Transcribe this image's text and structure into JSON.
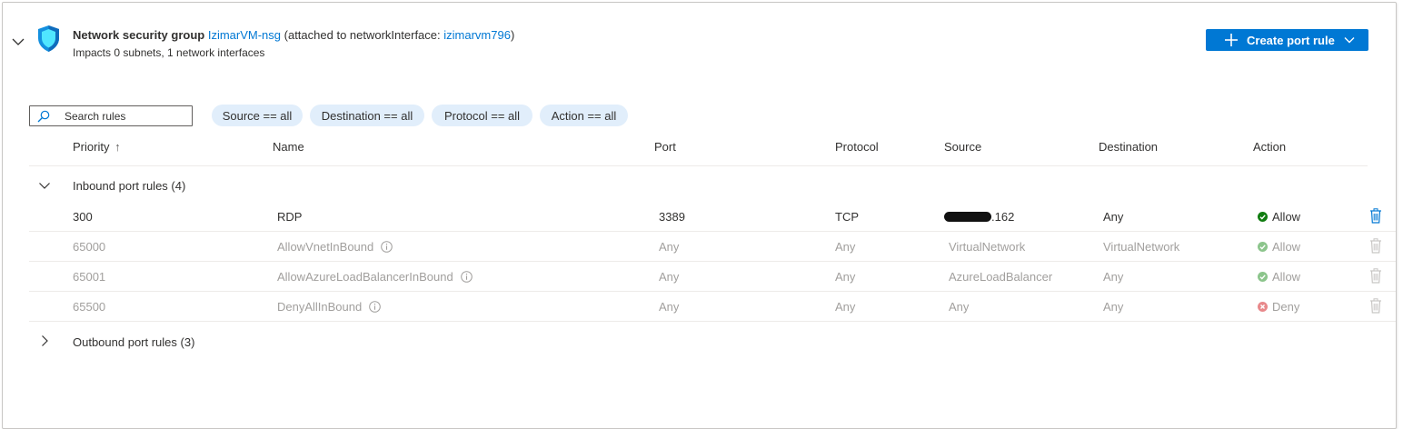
{
  "nsg": {
    "label": "Network security group",
    "name": "IzimarVM-nsg",
    "attached_prefix": "(attached to networkInterface: ",
    "interface_name": "izimarvm796",
    "attached_suffix": ")",
    "impacts": "Impacts 0 subnets, 1 network interfaces"
  },
  "actions": {
    "create_label": "Create port rule"
  },
  "search": {
    "placeholder": "Search rules"
  },
  "filters": [
    "Source == all",
    "Destination == all",
    "Protocol == all",
    "Action == all"
  ],
  "columns": {
    "priority": "Priority",
    "sort_arrow": "↑",
    "name": "Name",
    "port": "Port",
    "protocol": "Protocol",
    "source": "Source",
    "destination": "Destination",
    "action": "Action"
  },
  "inbound": {
    "label": "Inbound port rules (4)",
    "rules": [
      {
        "priority": "300",
        "name": "RDP",
        "port": "3389",
        "protocol": "TCP",
        "source_suffix": ".162",
        "destination": "Any",
        "action": "Allow"
      },
      {
        "priority": "65000",
        "name": "AllowVnetInBound",
        "port": "Any",
        "protocol": "Any",
        "source": "VirtualNetwork",
        "destination": "VirtualNetwork",
        "action": "Allow"
      },
      {
        "priority": "65001",
        "name": "AllowAzureLoadBalancerInBound",
        "port": "Any",
        "protocol": "Any",
        "source": "AzureLoadBalancer",
        "destination": "Any",
        "action": "Allow"
      },
      {
        "priority": "65500",
        "name": "DenyAllInBound",
        "port": "Any",
        "protocol": "Any",
        "source": "Any",
        "destination": "Any",
        "action": "Deny"
      }
    ]
  },
  "outbound": {
    "label": "Outbound port rules (3)"
  },
  "colors": {
    "accent": "#0078d4",
    "allow": "#107c10",
    "deny": "#d13438",
    "pill": "#e1eefb"
  }
}
